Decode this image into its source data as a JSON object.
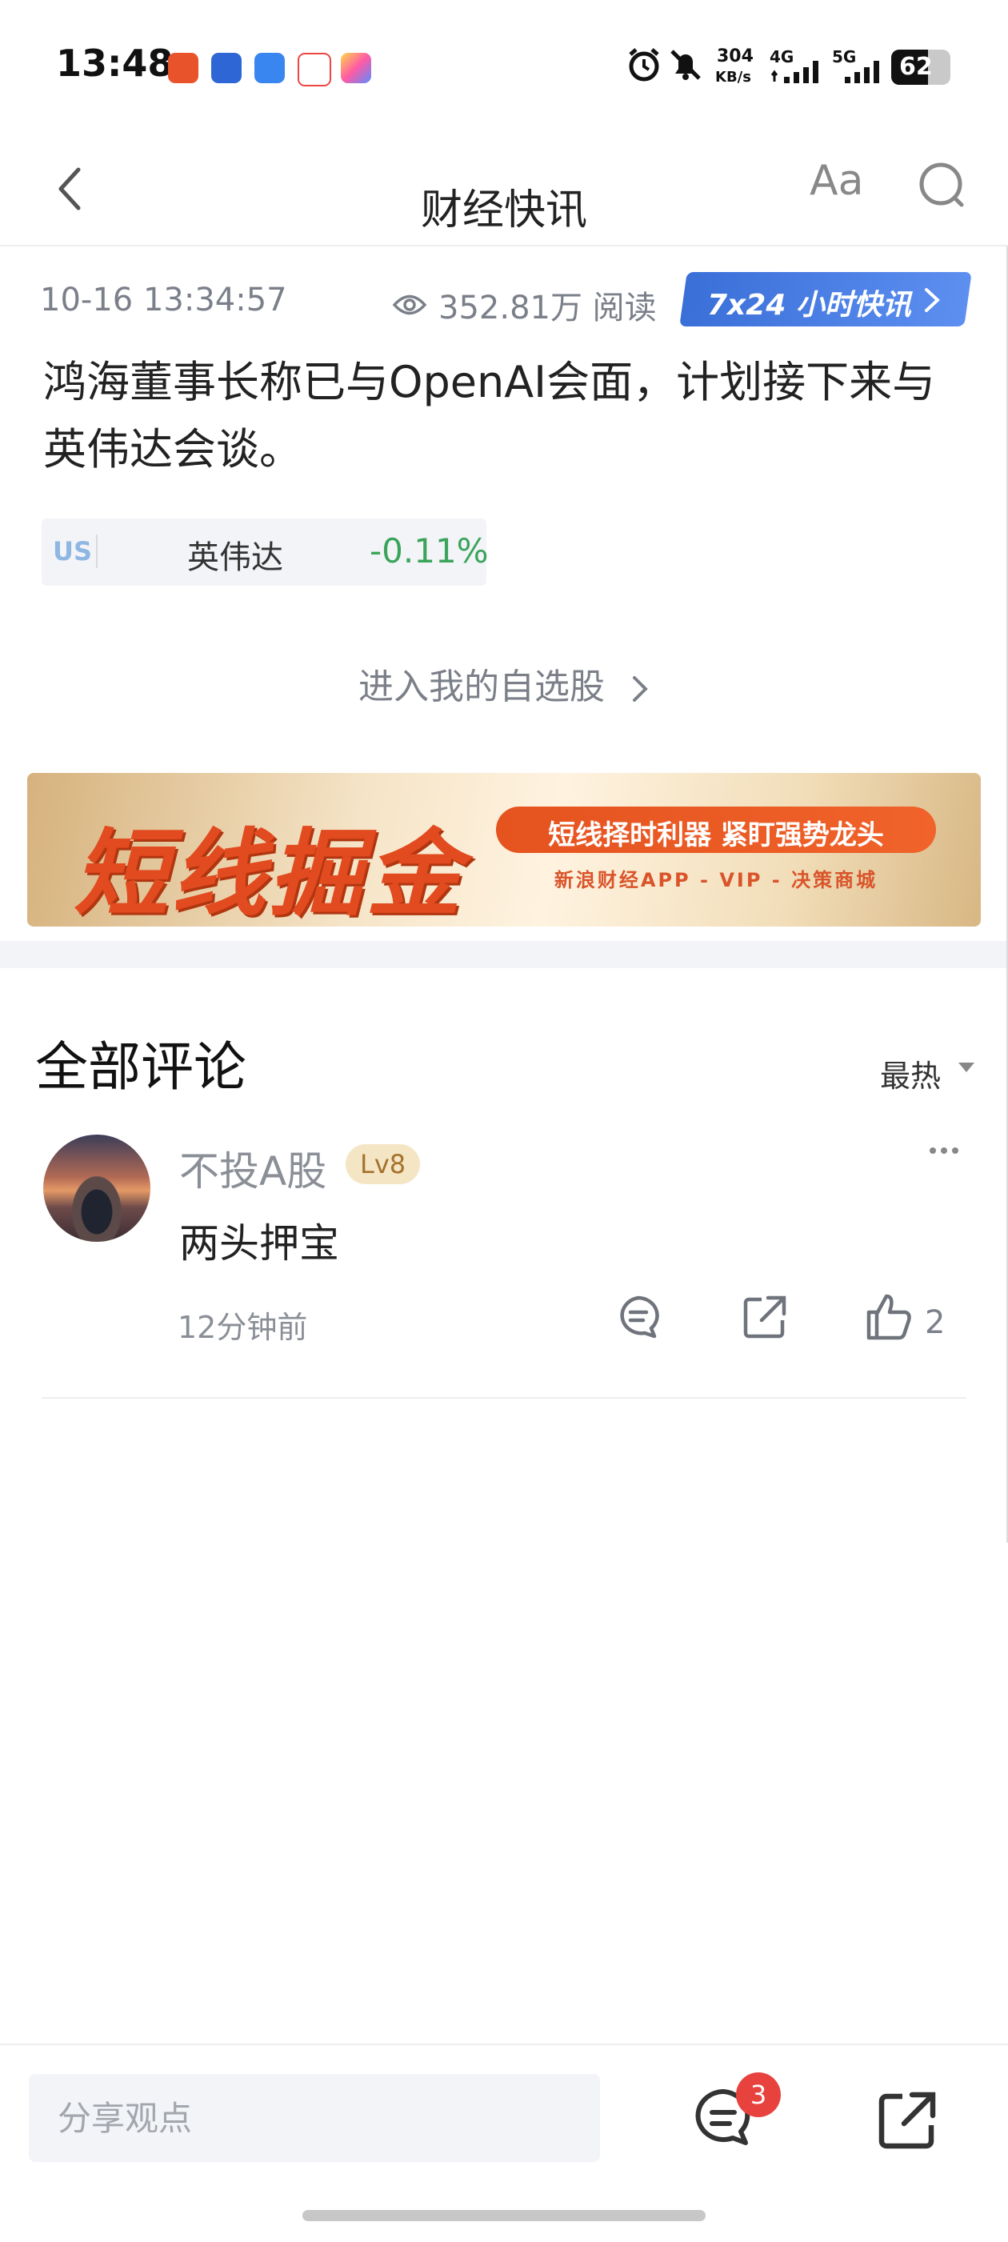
{
  "status_bar": {
    "time": "13:48",
    "network_speed": "304",
    "network_speed_unit": "KB/s",
    "signal_1": "4G",
    "signal_2": "5G",
    "battery": "62"
  },
  "nav": {
    "title": "财经快讯",
    "font_button": "Aa"
  },
  "article": {
    "timestamp": "10-16 13:34:57",
    "read_count": "352.81万 阅读",
    "live_banner": "7x24 小时快讯",
    "headline": "鸿海董事长称已与OpenAI会面，计划接下来与英伟达会谈。",
    "stock": {
      "market": "US",
      "name": "英伟达",
      "change": "-0.11%"
    },
    "watchlist_link": "进入我的自选股"
  },
  "ad": {
    "title": "短线掘金",
    "slogan": "短线择时利器 紧盯强势龙头",
    "sub": "新浪财经APP - VIP - 决策商城"
  },
  "comments": {
    "title": "全部评论",
    "sort": "最热",
    "items": [
      {
        "user": "不投A股",
        "level": "Lv8",
        "text": "两头押宝",
        "time": "12分钟前",
        "likes": "2"
      }
    ]
  },
  "bottom_bar": {
    "input_placeholder": "分享观点",
    "comment_badge": "3"
  },
  "colors": {
    "accent_blue": "#3a6fd8",
    "stock_green": "#3aa45a",
    "ad_orange": "#e24a1f",
    "badge_red": "#e8423f"
  }
}
